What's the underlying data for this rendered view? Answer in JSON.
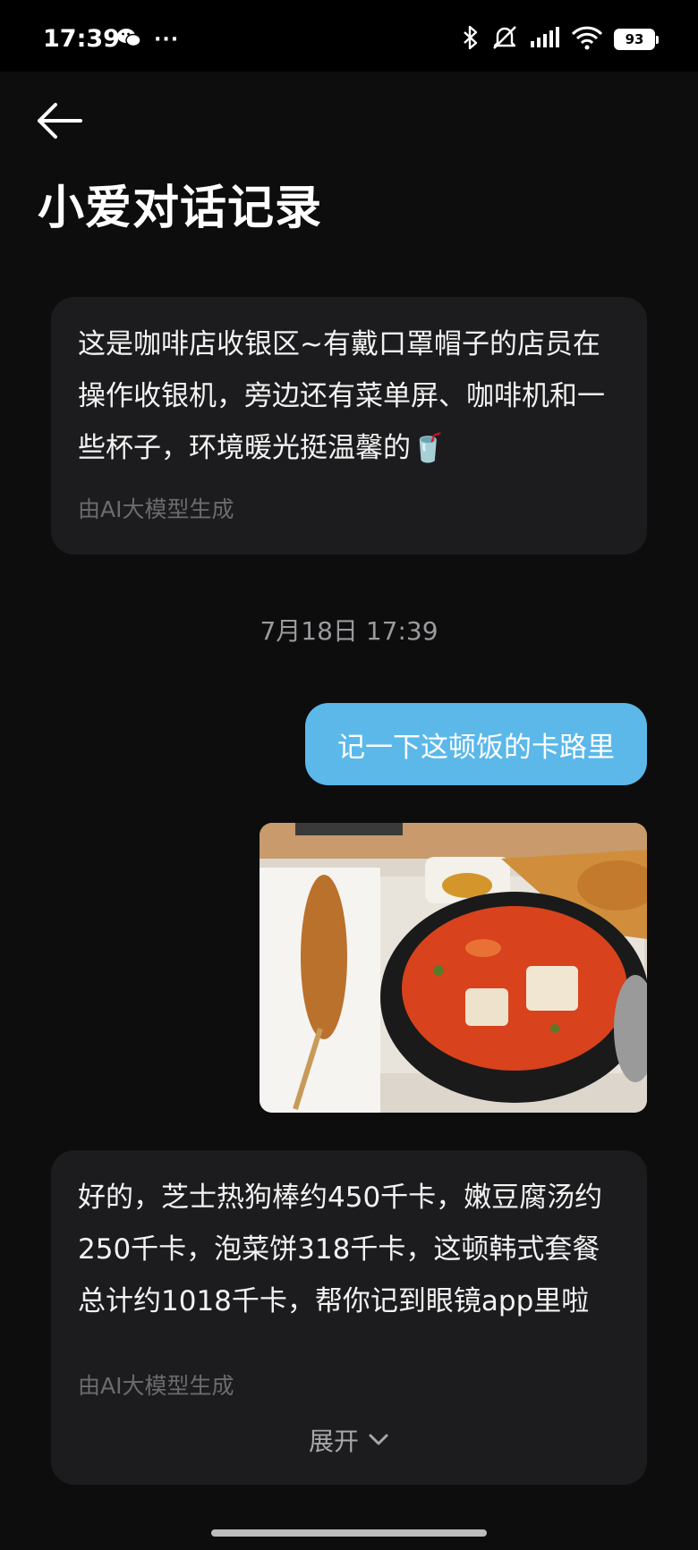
{
  "status_bar": {
    "time": "17:39",
    "battery": "93",
    "more_dots": "···"
  },
  "header": {
    "title": "小爱对话记录"
  },
  "messages": [
    {
      "role": "assistant",
      "text": "这是咖啡店收银区~有戴口罩帽子的店员在操作收银机，旁边还有菜单屏、咖啡机和一些杯子，环境暖光挺温馨的🥤",
      "ai_note": "由AI大模型生成"
    },
    {
      "role": "timestamp",
      "text": "7月18日 17:39"
    },
    {
      "role": "user",
      "text": "记一下这顿饭的卡路里"
    },
    {
      "role": "user_image",
      "icon": "food-photo"
    },
    {
      "role": "assistant",
      "text": "好的，芝士热狗棒约450千卡，嫩豆腐汤约250千卡，泡菜饼318千卡，这顿韩式套餐总计约1018千卡，帮你记到眼镜app里啦",
      "ai_note": "由AI大模型生成",
      "expand_label": "展开"
    }
  ],
  "colors": {
    "background": "#0d0d0d",
    "card": "#1c1c1e",
    "user_bubble": "#5bb8e9",
    "muted_text": "#6b6b6e"
  }
}
